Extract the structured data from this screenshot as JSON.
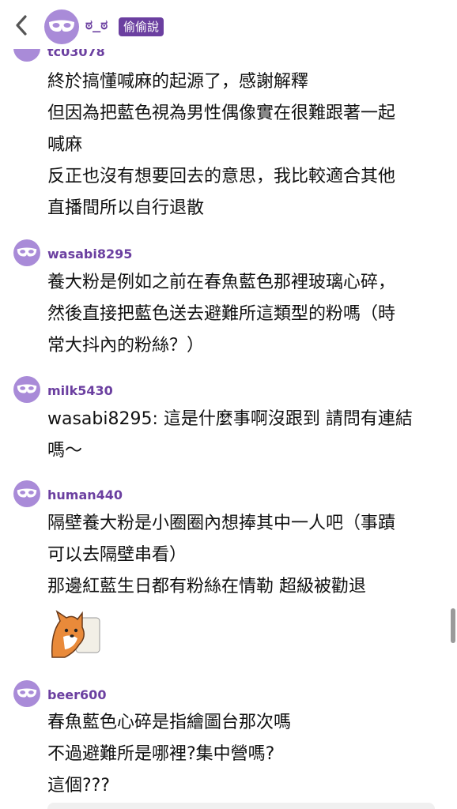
{
  "header": {
    "title": "ಠ_ಠ",
    "badge": "偷偷說"
  },
  "previous_user": "tc03078",
  "comments": [
    {
      "username": null,
      "lines": [
        "終於搞懂喊麻的起源了，感謝解釋",
        "但因為把藍色視為男性偶像實在很難跟著一起",
        "喊麻",
        "反正也沒有想要回去的意思，我比較適合其他",
        "直播間所以自行退散"
      ]
    },
    {
      "username": "wasabi8295",
      "lines": [
        "養大粉是例如之前在春魚藍色那裡玻璃心碎，",
        "然後直接把藍色送去避難所這類型的粉嗎（時",
        "常大抖內的粉絲？）"
      ]
    },
    {
      "username": "milk5430",
      "lines": [
        "wasabi8295: 這是什麼事啊沒跟到 請問有連結",
        "嗎～"
      ]
    },
    {
      "username": "human440",
      "lines": [
        "隔壁養大粉是小圈圈內想捧其中一人吧（事蹟",
        "可以去隔壁串看）",
        "那邊紅藍生日都有粉絲在情勒 超級被勸退"
      ]
    },
    {
      "username": "beer600",
      "lines": [
        "春魚藍色心碎是指繪圖台那次嗎",
        "不過避難所是哪裡?集中營嗎?",
        "這個???"
      ]
    }
  ]
}
